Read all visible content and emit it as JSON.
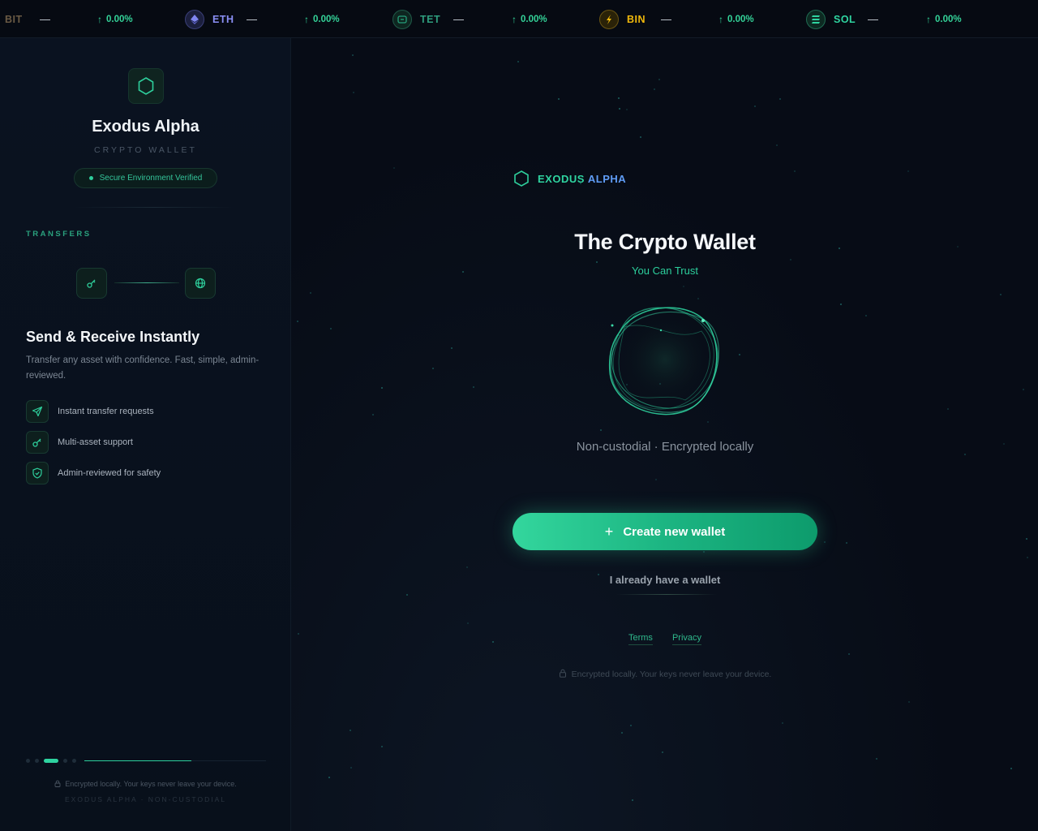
{
  "ticker": [
    {
      "symbol": "BIT",
      "price": "—",
      "change": "0.00%",
      "color": "#f7931a",
      "icon": "bitcoin-icon"
    },
    {
      "symbol": "ETH",
      "price": "—",
      "change": "0.00%",
      "color": "#8a8ff5",
      "icon": "ethereum-icon"
    },
    {
      "symbol": "TET",
      "price": "—",
      "change": "0.00%",
      "color": "#26a17b",
      "icon": "tether-icon"
    },
    {
      "symbol": "BIN",
      "price": "—",
      "change": "0.00%",
      "color": "#f0b90b",
      "icon": "binance-icon"
    },
    {
      "symbol": "SOL",
      "price": "—",
      "change": "0.00%",
      "color": "#2fd4a0",
      "icon": "solana-icon"
    }
  ],
  "sidebar": {
    "brand_title": "Exodus Alpha",
    "brand_subtitle": "CRYPTO WALLET",
    "verified_label": "Secure Environment Verified",
    "section_label": "TRANSFERS",
    "feature_title": "Send & Receive Instantly",
    "feature_desc": "Transfer any asset with confidence. Fast, simple, admin-reviewed.",
    "features": [
      {
        "label": "Instant transfer requests",
        "icon": "send-icon"
      },
      {
        "label": "Multi-asset support",
        "icon": "key-icon"
      },
      {
        "label": "Admin-reviewed for safety",
        "icon": "shield-check-icon"
      }
    ],
    "slides": {
      "count": 5,
      "active": 2,
      "progress": 0.59
    },
    "footer_note": "Encrypted locally. Your keys never leave your device.",
    "footer_tag": "EXODUS ALPHA · NON-CUSTODIAL"
  },
  "main": {
    "brand_a": "EXODUS",
    "brand_b": "ALPHA",
    "title": "The Crypto Wallet",
    "subtitle": "You Can Trust",
    "tagline": "Non-custodial · Encrypted locally",
    "create_label": "Create new wallet",
    "existing_label": "I already have a wallet",
    "terms_label": "Terms",
    "privacy_label": "Privacy",
    "footer_note": "Encrypted locally. Your keys never leave your device."
  },
  "colors": {
    "accent": "#2ecf9c",
    "accent_blue": "#5f9cf5",
    "background": "#070c16"
  }
}
